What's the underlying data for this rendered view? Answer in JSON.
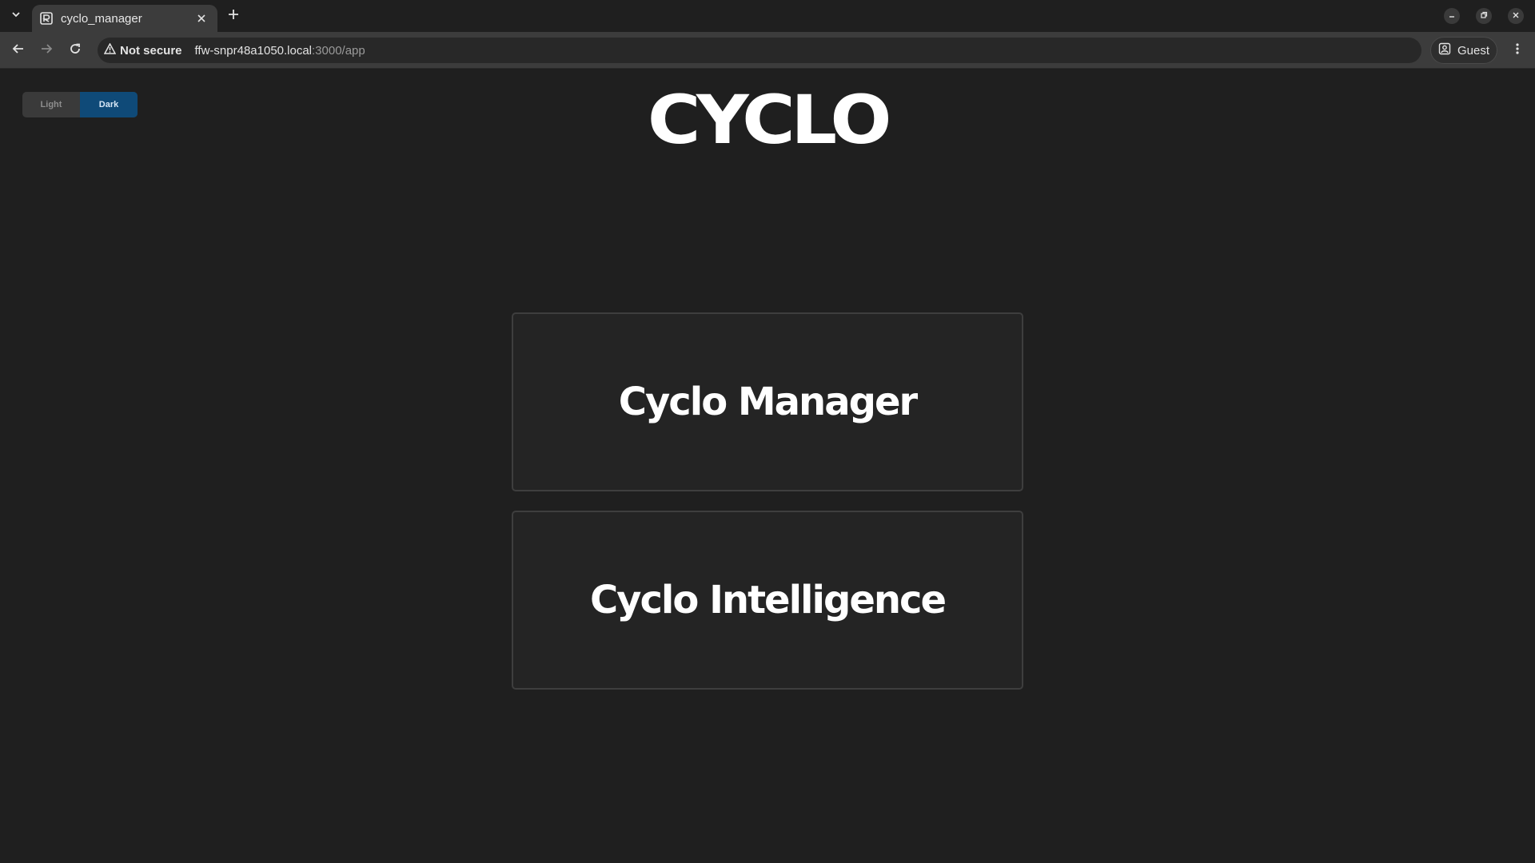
{
  "browser": {
    "tab": {
      "title": "cyclo_manager"
    },
    "address": {
      "security_label": "Not secure",
      "url_host": "ffw-snpr48a1050.local",
      "url_rest": ":3000/app"
    },
    "profile_label": "Guest"
  },
  "page": {
    "logo": "CYCLO",
    "theme": {
      "light_label": "Light",
      "dark_label": "Dark",
      "selected": "Dark"
    },
    "cards": [
      {
        "label": "Cyclo Manager"
      },
      {
        "label": "Cyclo Intelligence"
      }
    ]
  },
  "colors": {
    "background": "#1f1f1f",
    "card": "#242424",
    "accent": "#0f4a78"
  }
}
